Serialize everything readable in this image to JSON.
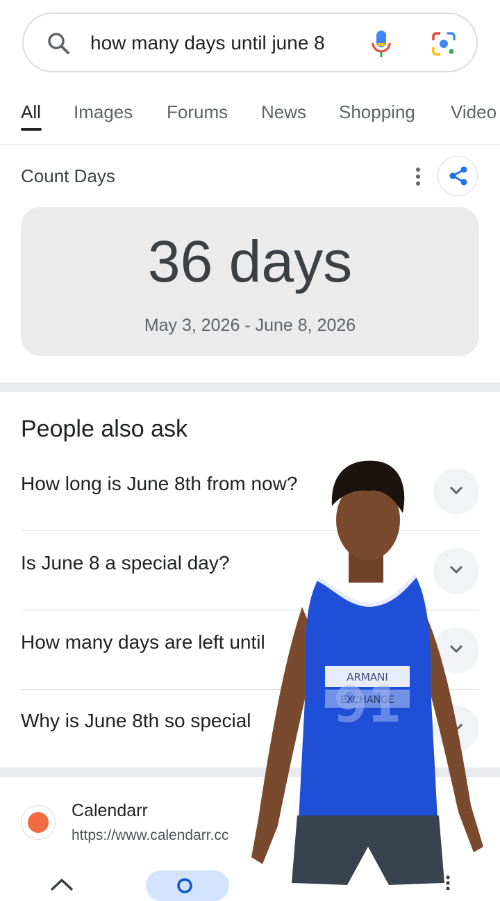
{
  "search": {
    "query": "how many days until june 8"
  },
  "tabs": [
    {
      "label": "All",
      "active": true
    },
    {
      "label": "Images"
    },
    {
      "label": "Forums"
    },
    {
      "label": "News"
    },
    {
      "label": "Shopping"
    },
    {
      "label": "Video"
    }
  ],
  "count_days": {
    "title": "Count Days",
    "value": "36 days",
    "range": "May 3, 2026 - June 8, 2026"
  },
  "people_also_ask": {
    "title": "People also ask",
    "questions": [
      "How long is June 8th from now?",
      "Is June 8 a special day?",
      "How many days are left until",
      "Why is June 8th so special"
    ]
  },
  "result": {
    "site": "Calendarr",
    "url": "https://www.calendarr.cc"
  },
  "overlay": {
    "shirt_text_1": "ARMANI",
    "shirt_text_2": "EXCHANGE",
    "shirt_number": "91"
  },
  "colors": {
    "accent_blue": "#1a73e8",
    "card_bg": "#ebebeb",
    "nav_pill": "#d3e3fd",
    "favicon": "#f26a3f",
    "jersey": "#1f4fd6"
  },
  "icons": [
    "search-icon",
    "mic-icon",
    "lens-icon",
    "kebab-icon",
    "share-icon",
    "chevron-down-icon",
    "home-icon",
    "more-icon"
  ]
}
